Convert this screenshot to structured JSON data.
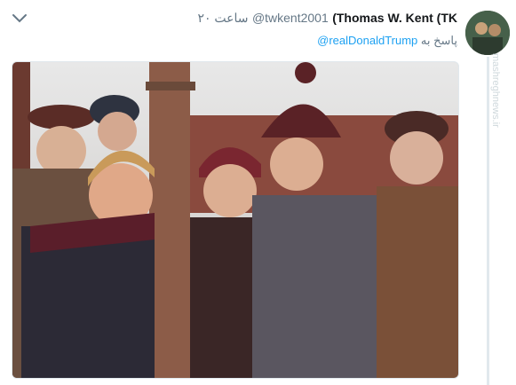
{
  "tweet": {
    "author_name": "(Thomas W. Kent (TK",
    "author_handle": "@twkent2001",
    "time_text": "۲۰ ساعت",
    "reply_prefix": "پاسخ به",
    "reply_to": "@realDonaldTrump"
  },
  "watermark": {
    "text": "mashreghnews.ir"
  },
  "icons": {
    "menu": "chevron-down-icon",
    "avatar": "profile-avatar"
  },
  "colors": {
    "link": "#1da1f2",
    "secondary_text": "#657786",
    "primary_text": "#14171a",
    "border": "#e1e8ed"
  }
}
